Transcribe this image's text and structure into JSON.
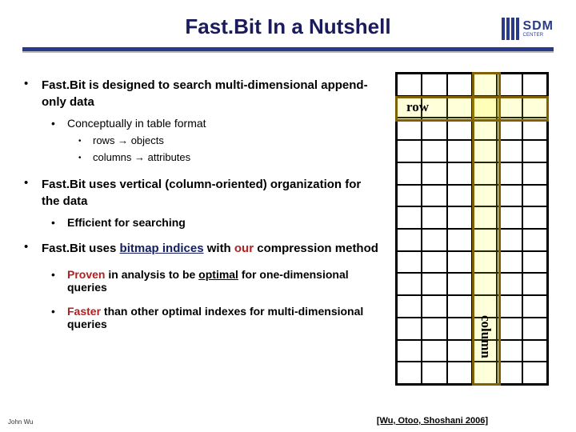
{
  "title": "Fast.Bit In a Nutshell",
  "logo": {
    "main": "SDM",
    "sub": "CENTER"
  },
  "b1": "Fast.Bit is designed to search multi-dimensional append-only data",
  "b1_1": "Conceptually in table format",
  "b1_1_1_a": "rows",
  "b1_1_1_b": "objects",
  "b1_1_2_a": "columns",
  "b1_1_2_b": "attributes",
  "b2": "Fast.Bit uses vertical (column-oriented) organization for the data",
  "b2_1": "Efficient for searching",
  "b3_a": "Fast.Bit uses ",
  "b3_b": "bitmap indices",
  "b3_c": " with ",
  "b3_d": "our",
  "b3_e": " compression method",
  "b3_1_a": "Proven",
  "b3_1_b": " in analysis to be ",
  "b3_1_c": "optimal",
  "b3_1_d": " for one-dimensional queries",
  "b3_2_a": "Faster",
  "b3_2_b": " than other optimal indexes for multi-dimensional queries",
  "citation": "[Wu, Otoo, Shoshani 2006]",
  "author": "John Wu",
  "diagram": {
    "row_label": "row",
    "col_label": "column"
  },
  "arrow": "→"
}
